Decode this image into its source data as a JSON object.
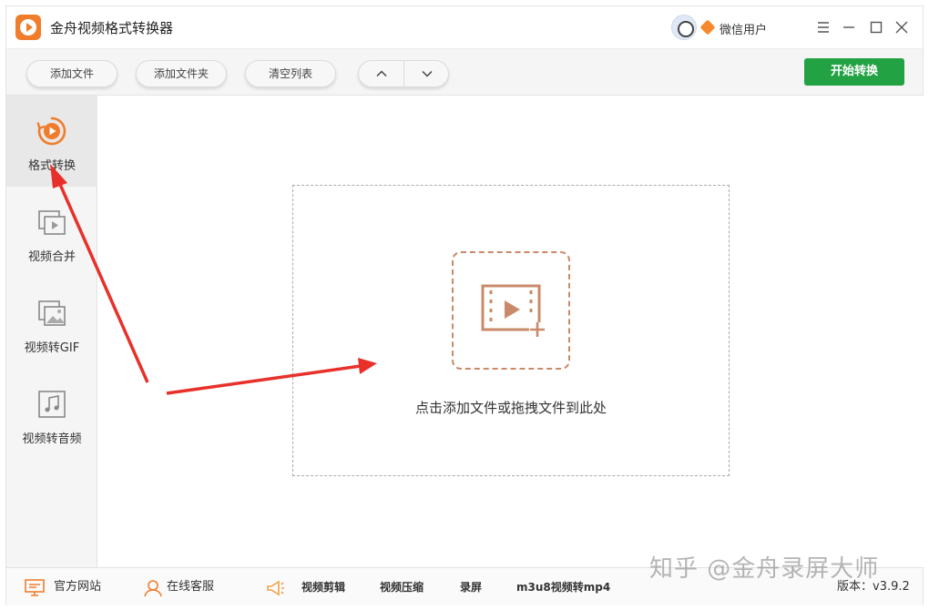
{
  "app": {
    "title": "金舟视频格式转换器",
    "user_name": "微信用户"
  },
  "toolbar": {
    "add_file": "添加文件",
    "add_folder": "添加文件夹",
    "clear_list": "清空列表",
    "start_convert": "开始转换"
  },
  "sidebar": {
    "items": [
      {
        "label": "格式转换",
        "icon": "format-convert-icon",
        "active": true
      },
      {
        "label": "视频合并",
        "icon": "video-merge-icon",
        "active": false
      },
      {
        "label": "视频转GIF",
        "icon": "video-to-gif-icon",
        "active": false
      },
      {
        "label": "视频转音频",
        "icon": "video-to-audio-icon",
        "active": false
      }
    ]
  },
  "main": {
    "drop_hint": "点击添加文件或拖拽文件到此处"
  },
  "statusbar": {
    "official_site": "官方网站",
    "online_service": "在线客服",
    "video_edit": "视频剪辑",
    "video_compress": "视频压缩",
    "screen_record": "录屏",
    "m3u8_to_mp4": "m3u8视频转mp4",
    "version": "版本：v3.9.2"
  },
  "watermark": "知乎 @金舟录屏大师",
  "colors": {
    "accent": "#f07d2c",
    "start_button": "#23a244",
    "arrow": "#e8302a"
  }
}
